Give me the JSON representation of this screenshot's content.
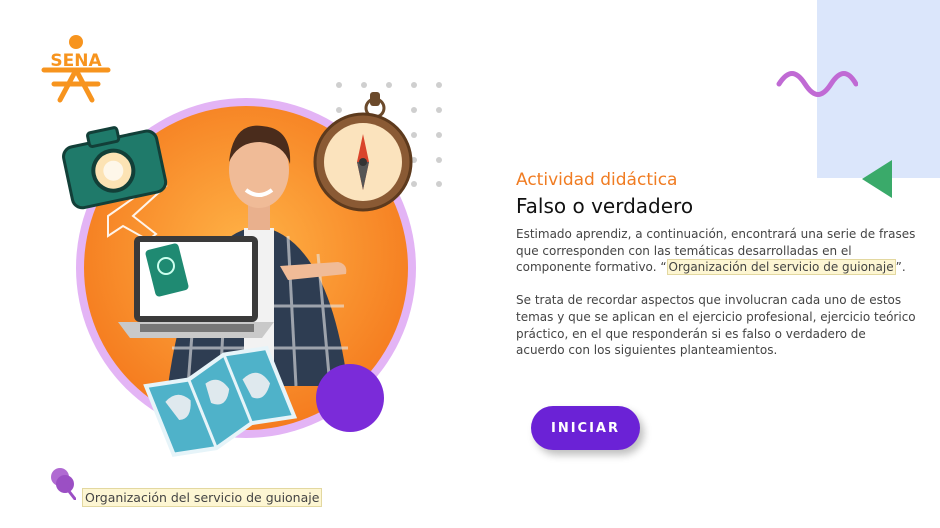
{
  "logo": {
    "text": "SENA",
    "color": "#f7941e"
  },
  "content": {
    "eyebrow": "Actividad didáctica",
    "title": "Falso o verdadero",
    "intro_before": "Estimado aprendiz, a continuación, encontrará una serie de frases que corresponden con las temáticas desarrolladas en el componente formativo. “",
    "intro_highlight": "Organización del servicio de guionaje",
    "intro_after": "”.",
    "paragraph2": "Se trata de recordar aspectos que involucran cada uno de estos temas y que se aplican en el ejercicio profesional, ejercicio teórico práctico, en el que responderán si es falso o verdadero de acuerdo con los siguientes planteamientos."
  },
  "button": {
    "label": "INICIAR",
    "color": "#6b22d6"
  },
  "footer": {
    "label": "Organización del servicio de guionaje"
  },
  "colors": {
    "accent": "#f07c22",
    "purple": "#6b22d6",
    "wave": "#c06ad4",
    "triangle": "#3aaa6a",
    "panel": "#dbe6fb"
  }
}
